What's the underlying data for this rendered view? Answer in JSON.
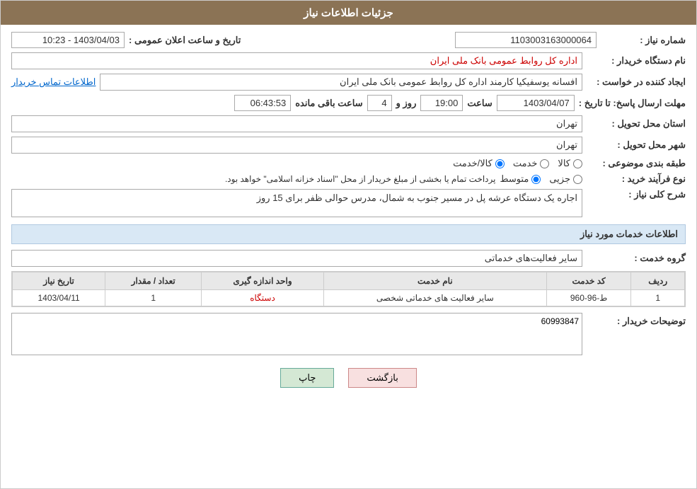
{
  "header": {
    "title": "جزئیات اطلاعات نیاز"
  },
  "fields": {
    "need_number_label": "شماره نیاز :",
    "need_number_value": "1103003163000064",
    "buyer_name_label": "نام دستگاه خریدار :",
    "buyer_name_value": "اداره کل روابط عمومی بانک ملی ایران",
    "creator_label": "ایجاد کننده در خواست :",
    "creator_value": "افسانه یوسفیکیا کارمند اداره کل روابط عمومی بانک ملی ایران",
    "creator_link": "اطلاعات تماس خریدار",
    "deadline_label": "مهلت ارسال پاسخ: تا تاریخ :",
    "deadline_date": "1403/04/07",
    "deadline_time_label": "ساعت",
    "deadline_time": "19:00",
    "deadline_days_label": "روز و",
    "deadline_days": "4",
    "deadline_remaining_label": "ساعت باقی مانده",
    "deadline_remaining": "06:43:53",
    "announcement_label": "تاریخ و ساعت اعلان عمومی :",
    "announcement_value": "1403/04/03 - 10:23",
    "province_label": "استان محل تحویل :",
    "province_value": "تهران",
    "city_label": "شهر محل تحویل :",
    "city_value": "تهران",
    "category_label": "طبقه بندی موضوعی :",
    "category_options": [
      {
        "label": "کالا",
        "selected": false
      },
      {
        "label": "خدمت",
        "selected": false
      },
      {
        "label": "کالا/خدمت",
        "selected": false
      }
    ],
    "purchase_type_label": "نوع فرآیند خرید :",
    "purchase_type_options": [
      {
        "label": "جزیی",
        "selected": false
      },
      {
        "label": "متوسط",
        "selected": false
      }
    ],
    "purchase_type_note": "پرداخت تمام یا بخشی از مبلغ خریدار از محل \"اسناد خزانه اسلامی\" خواهد بود.",
    "description_label": "شرح کلی نیاز :",
    "description_value": "اجاره یک دستگاه عرشه پل در مسیر جنوب به شمال، مدرس حوالی ظفر برای 15 روز",
    "services_title": "اطلاعات خدمات مورد نیاز",
    "service_group_label": "گروه خدمت :",
    "service_group_value": "سایر فعالیت‌های خدماتی",
    "table": {
      "headers": [
        "ردیف",
        "کد خدمت",
        "نام خدمت",
        "واحد اندازه گیری",
        "تعداد / مقدار",
        "تاریخ نیاز"
      ],
      "rows": [
        {
          "row_num": "1",
          "service_code": "ط-96-960",
          "service_name": "سایر فعالیت های خدماتی شخصی",
          "unit": "دستگاه",
          "quantity": "1",
          "date": "1403/04/11"
        }
      ]
    },
    "buyer_desc_label": "توضیحات خریدار :",
    "buyer_desc_value": "60993847"
  },
  "buttons": {
    "print": "چاپ",
    "back": "بازگشت"
  }
}
